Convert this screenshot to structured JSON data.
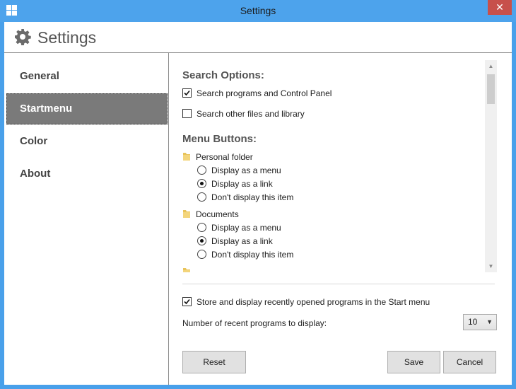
{
  "window": {
    "title": "Settings",
    "close_glyph": "✕"
  },
  "header": {
    "title": "Settings",
    "icon": "gear-icon"
  },
  "sidebar": {
    "items": [
      {
        "label": "General",
        "selected": false
      },
      {
        "label": "Startmenu",
        "selected": true
      },
      {
        "label": "Color",
        "selected": false
      },
      {
        "label": "About",
        "selected": false
      }
    ]
  },
  "search_options": {
    "heading": "Search Options:",
    "search_programs": {
      "label": "Search programs and Control Panel",
      "checked": true
    },
    "search_files": {
      "label": "Search other files and library",
      "checked": false
    }
  },
  "menu_buttons": {
    "heading": "Menu Buttons:",
    "groups": [
      {
        "label": "Personal folder",
        "options": [
          {
            "label": "Display as a menu",
            "selected": false
          },
          {
            "label": "Display as a link",
            "selected": true
          },
          {
            "label": "Don't display this item",
            "selected": false
          }
        ]
      },
      {
        "label": "Documents",
        "options": [
          {
            "label": "Display as a menu",
            "selected": false
          },
          {
            "label": "Display as a link",
            "selected": true
          },
          {
            "label": "Don't display this item",
            "selected": false
          }
        ]
      }
    ]
  },
  "recent": {
    "store_label": "Store and display recently opened programs in the Start menu",
    "store_checked": true,
    "count_label": "Number of recent programs to display:",
    "count_value": "10"
  },
  "buttons": {
    "reset": "Reset",
    "save": "Save",
    "cancel": "Cancel"
  },
  "colors": {
    "titlebar": "#4da3ec",
    "close": "#c7504b",
    "selected_nav": "#7a7a7a"
  }
}
